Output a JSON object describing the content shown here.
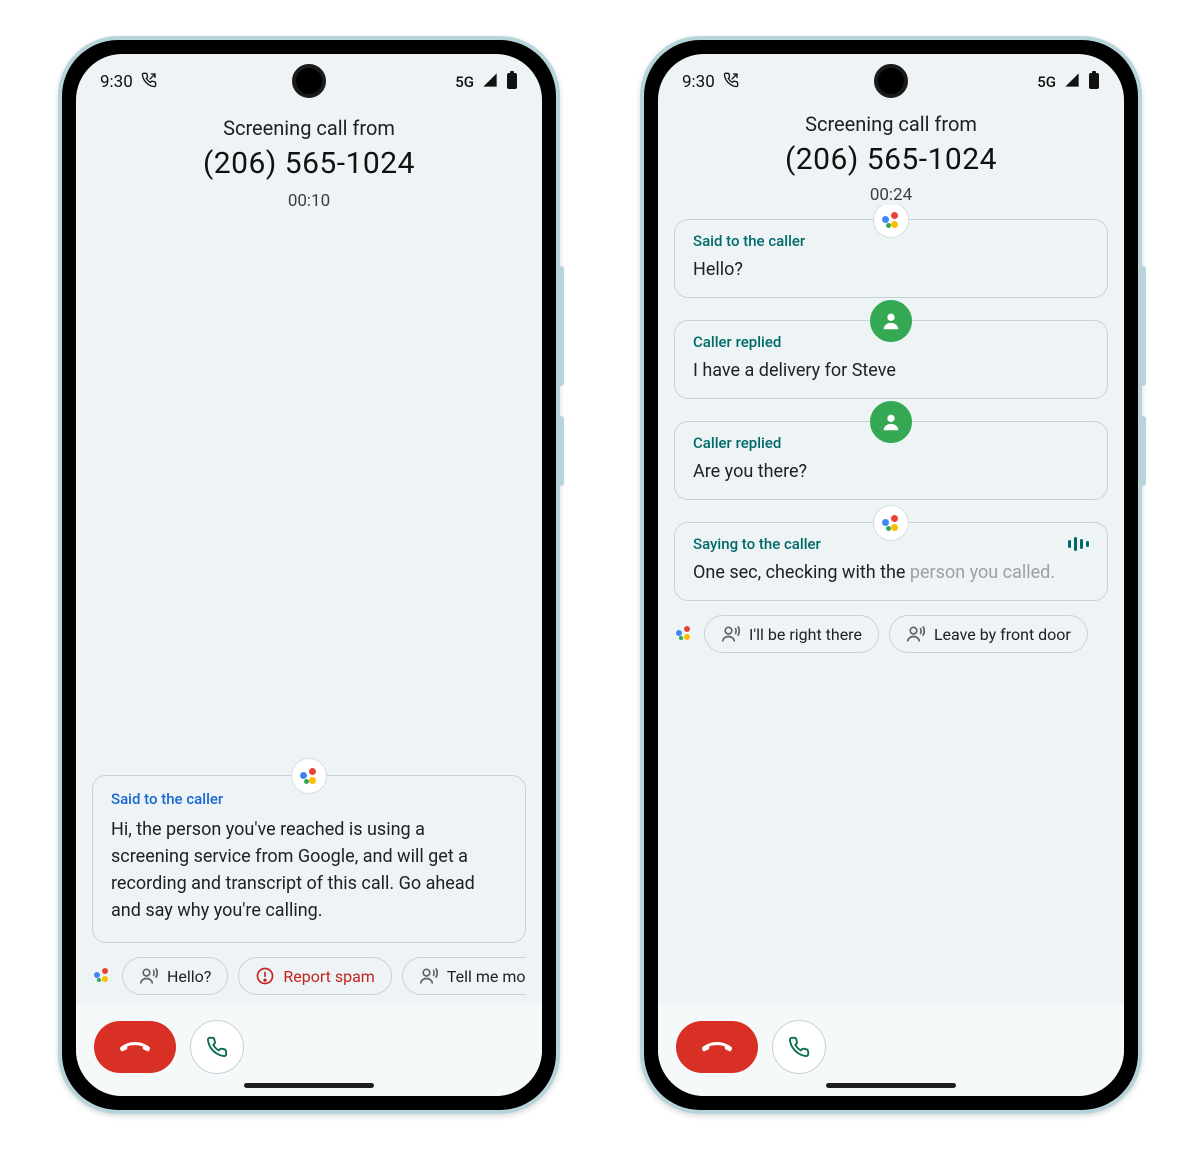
{
  "status": {
    "time": "9:30",
    "network": "5G"
  },
  "left": {
    "header": {
      "line1": "Screening call from",
      "number": "(206) 565-1024",
      "elapsed": "00:10"
    },
    "card": {
      "label": "Said to the caller",
      "text": "Hi, the person you've reached is using a screening service from Google, and will get a recording and transcript of this call. Go ahead and say why you're calling."
    },
    "chips": [
      {
        "icon": "speak",
        "label": "Hello?"
      },
      {
        "icon": "alert",
        "label": "Report spam"
      },
      {
        "icon": "speak",
        "label": "Tell me mo"
      }
    ]
  },
  "right": {
    "header": {
      "line1": "Screening call from",
      "number": "(206) 565-1024",
      "elapsed": "00:24"
    },
    "cards": [
      {
        "kind": "assistant",
        "label": "Said to the caller",
        "text": "Hello?"
      },
      {
        "kind": "caller",
        "label": "Caller replied",
        "text": "I have a delivery for Steve"
      },
      {
        "kind": "caller",
        "label": "Caller replied",
        "text": "Are you there?"
      },
      {
        "kind": "assistant-live",
        "label": "Saying to the caller",
        "text": "One sec, checking with the ",
        "text_fade": "person you called."
      }
    ],
    "chips": [
      {
        "icon": "speak",
        "label": "I'll be right there"
      },
      {
        "icon": "speak",
        "label": "Leave by front door"
      }
    ]
  }
}
